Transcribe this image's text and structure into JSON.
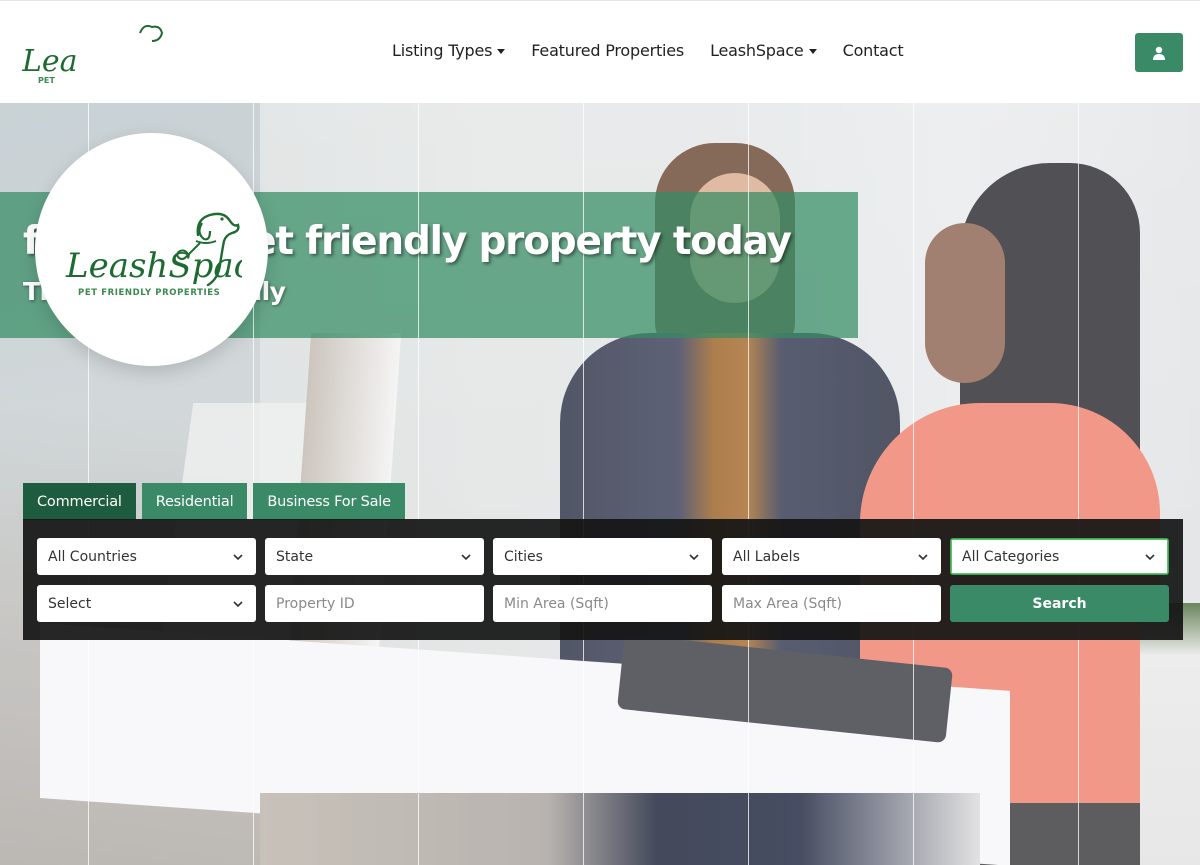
{
  "brand": {
    "name": "LeashSpace",
    "tagline": "PET FRIENDLY PROPERTIES",
    "color": "#1e6b32"
  },
  "nav": {
    "items": [
      {
        "label": "Listing Types",
        "dropdown": true
      },
      {
        "label": "Featured Properties",
        "dropdown": false
      },
      {
        "label": "LeashSpace",
        "dropdown": true
      },
      {
        "label": "Contact",
        "dropdown": false
      }
    ],
    "user_button_icon": "user-icon"
  },
  "hero": {
    "headline": "find your pet friendly property today",
    "subheadline": "That is Pet Friendly",
    "accent_color": "#348c64"
  },
  "search": {
    "tabs": [
      {
        "label": "Commercial",
        "active": true
      },
      {
        "label": "Residential",
        "active": false
      },
      {
        "label": "Business For Sale",
        "active": false
      }
    ],
    "row1": [
      {
        "value": "All Countries",
        "type": "select"
      },
      {
        "value": "State",
        "type": "select"
      },
      {
        "value": "Cities",
        "type": "select"
      },
      {
        "value": "All Labels",
        "type": "select"
      },
      {
        "value": "All Categories",
        "type": "select",
        "focused": true
      }
    ],
    "row2": [
      {
        "value": "Select",
        "type": "select"
      },
      {
        "placeholder": "Property ID",
        "type": "input"
      },
      {
        "placeholder": "Min Area (Sqft)",
        "type": "input"
      },
      {
        "placeholder": "Max Area (Sqft)",
        "type": "input"
      }
    ],
    "submit_label": "Search",
    "button_color": "#3a8a68",
    "active_tab_color": "#1d5c3e"
  }
}
